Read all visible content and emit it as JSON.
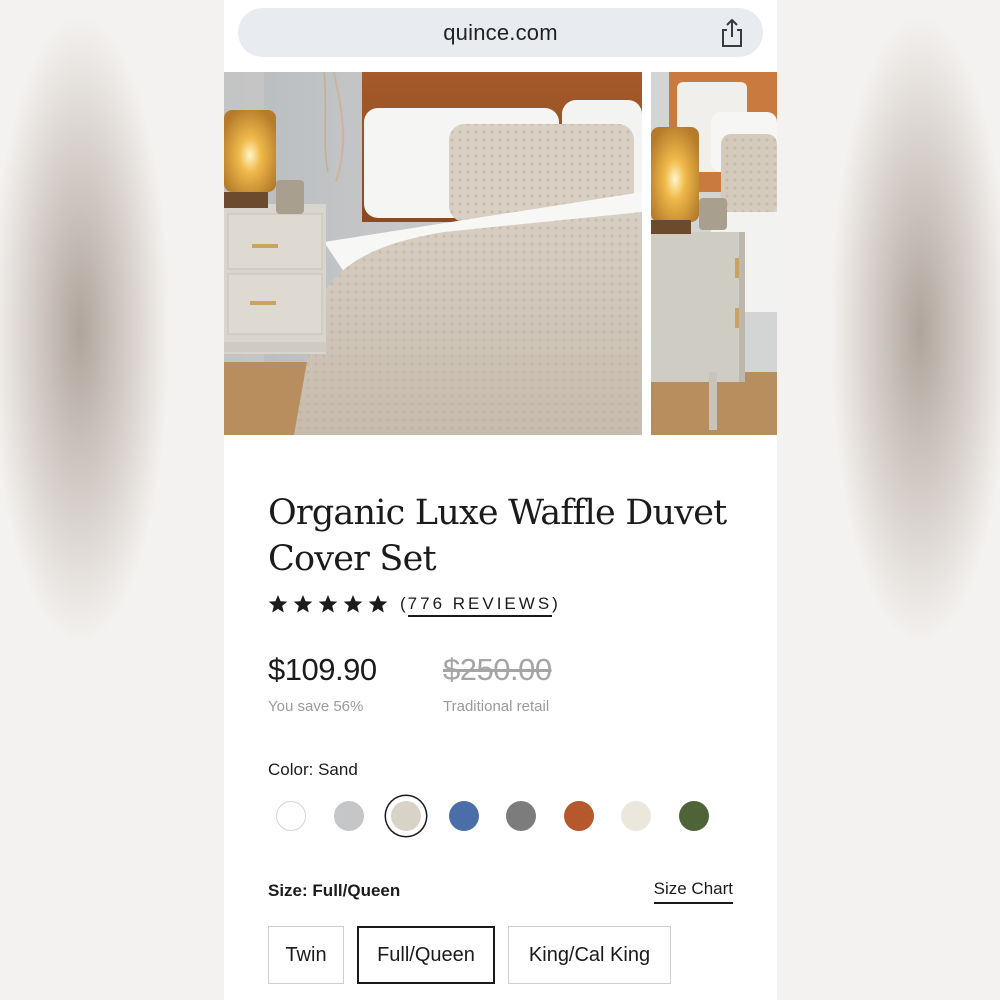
{
  "browser": {
    "url": "quince.com",
    "share_icon": "share-icon"
  },
  "product": {
    "title": "Organic Luxe Waffle Duvet Cover Set",
    "rating": {
      "stars": 5,
      "open": "(",
      "reviews_text": "776 REVIEWS",
      "close": ")"
    },
    "price": "$109.90",
    "save_text": "You save 56%",
    "retail_price": "$250.00",
    "retail_label": "Traditional retail"
  },
  "color": {
    "label": "Color:",
    "selected": "Sand",
    "swatches": [
      {
        "name": "white",
        "hex": "#ffffff"
      },
      {
        "name": "light-gray",
        "hex": "#c5c6c8"
      },
      {
        "name": "sand",
        "hex": "#d8d3c6"
      },
      {
        "name": "blue",
        "hex": "#4a6fa8"
      },
      {
        "name": "gray",
        "hex": "#7c7c7c"
      },
      {
        "name": "rust",
        "hex": "#b5582b"
      },
      {
        "name": "ivory",
        "hex": "#ebe7dc"
      },
      {
        "name": "green",
        "hex": "#4e6438"
      }
    ]
  },
  "size": {
    "label": "Size:",
    "selected": "Full/Queen",
    "chart_link": "Size Chart",
    "options": [
      "Twin",
      "Full/Queen",
      "King/Cal King"
    ]
  }
}
